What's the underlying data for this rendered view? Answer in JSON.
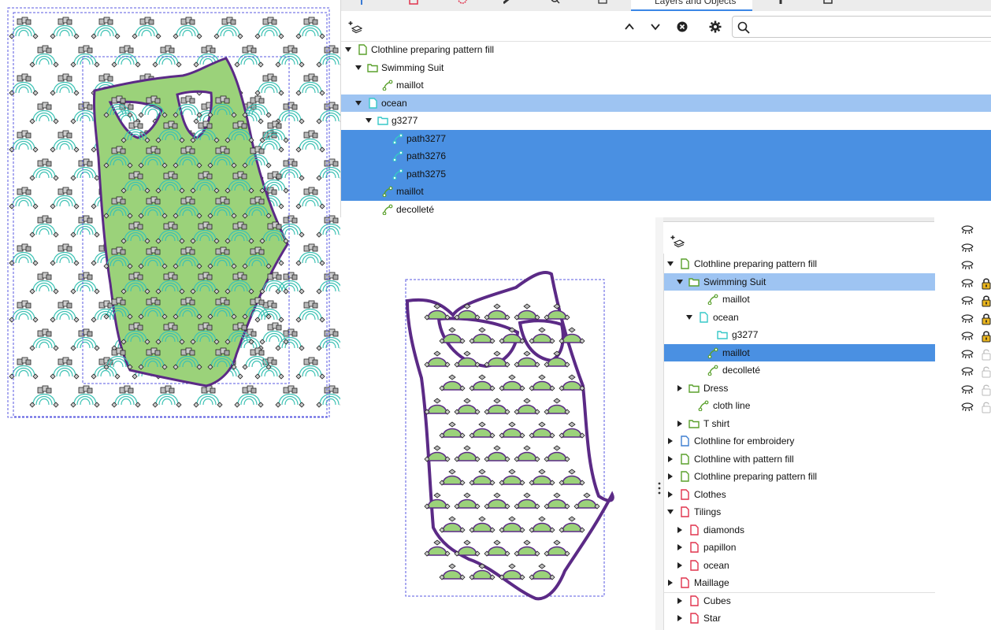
{
  "top_panel": {
    "tab_label": "Layers and Objects",
    "search": {
      "placeholder": "",
      "value": ""
    },
    "toolbar_icons": [
      "new-layer-icon",
      "raise-icon",
      "lower-icon",
      "delete-icon",
      "settings-icon",
      "search-icon"
    ],
    "rows": [
      {
        "label": "Clothline  preparing pattern fill",
        "indent": 0,
        "arrow": "down",
        "icon": "layer-icon",
        "color": "#5aa02c",
        "state": ""
      },
      {
        "label": "Swimming Suit",
        "indent": 1,
        "arrow": "down",
        "icon": "group-icon",
        "color": "#5aa02c",
        "state": ""
      },
      {
        "label": "maillot",
        "indent": 2,
        "arrow": "",
        "icon": "path-icon",
        "color": "#5aa02c",
        "state": ""
      },
      {
        "label": "ocean",
        "indent": 1,
        "arrow": "down",
        "icon": "layer-icon",
        "color": "#37c8c8",
        "state": "light"
      },
      {
        "label": "g3277",
        "indent": 2,
        "arrow": "down",
        "icon": "group-icon",
        "color": "#37c8c8",
        "state": ""
      },
      {
        "label": "path3277",
        "indent": 3,
        "arrow": "",
        "icon": "path-icon",
        "color": "#37c8c8",
        "state": "dark"
      },
      {
        "label": "path3276",
        "indent": 3,
        "arrow": "",
        "icon": "path-icon",
        "color": "#37c8c8",
        "state": "dark"
      },
      {
        "label": "path3275",
        "indent": 3,
        "arrow": "",
        "icon": "path-icon",
        "color": "#37c8c8",
        "state": "dark"
      },
      {
        "label": "maillot",
        "indent": 2,
        "arrow": "",
        "icon": "path-icon",
        "color": "#5aa02c",
        "state": "dark"
      },
      {
        "label": "decolleté",
        "indent": 2,
        "arrow": "",
        "icon": "path-icon",
        "color": "#5aa02c",
        "state": ""
      }
    ]
  },
  "bottom_panel": {
    "toolbar_icons": [
      "new-layer-icon"
    ],
    "rows": [
      {
        "label": "Clothline  preparing pattern fill",
        "indent": 0,
        "arrow": "down",
        "icon": "layer-icon",
        "color": "#5aa02c",
        "state": "",
        "eye": true,
        "lock": ""
      },
      {
        "label": "Swimming Suit",
        "indent": 1,
        "arrow": "down",
        "icon": "group-icon",
        "color": "#5aa02c",
        "state": "light",
        "eye": true,
        "lock": ""
      },
      {
        "label": "maillot",
        "indent": 2,
        "arrow": "",
        "icon": "path-icon",
        "color": "#5aa02c",
        "state": "",
        "eye": true,
        "lock": ""
      },
      {
        "label": "ocean",
        "indent": 2,
        "arrow": "down",
        "icon": "layer-icon",
        "color": "#37c8c8",
        "state": "",
        "eye": true,
        "lock": "locked"
      },
      {
        "label": "g3277",
        "indent": 3,
        "arrow": "",
        "icon": "group-icon",
        "color": "#37c8c8",
        "state": "",
        "eye": true,
        "lock": "locked"
      },
      {
        "label": "maillot",
        "indent": 2,
        "arrow": "",
        "icon": "path-icon",
        "color": "#5aa02c",
        "state": "dark",
        "eye": true,
        "lock": "locked"
      },
      {
        "label": "decolleté",
        "indent": 2,
        "arrow": "",
        "icon": "path-icon",
        "color": "#5aa02c",
        "state": "",
        "eye": true,
        "lock": "locked"
      },
      {
        "label": "Dress",
        "indent": 1,
        "arrow": "right",
        "icon": "group-icon",
        "color": "#5aa02c",
        "state": "",
        "eye": true,
        "lock": "unlocked"
      },
      {
        "label": "cloth line",
        "indent": 1,
        "arrow": "",
        "icon": "path-icon",
        "color": "#5aa02c",
        "state": "",
        "eye": true,
        "lock": "unlocked"
      },
      {
        "label": "T shirt",
        "indent": 1,
        "arrow": "right",
        "icon": "group-icon",
        "color": "#5aa02c",
        "state": "",
        "eye": true,
        "lock": "unlocked"
      },
      {
        "label": "Clothline for embroidery",
        "indent": 0,
        "arrow": "right",
        "icon": "layer-icon",
        "color": "#3f7fd1",
        "state": "",
        "eye": true,
        "lock": "unlocked"
      },
      {
        "label": "Clothline  with pattern fill",
        "indent": 0,
        "arrow": "right",
        "icon": "layer-icon",
        "color": "#5aa02c",
        "state": "",
        "eye": false,
        "lock": ""
      },
      {
        "label": "Clothline  preparing pattern fill",
        "indent": 0,
        "arrow": "right",
        "icon": "layer-icon",
        "color": "#5aa02c",
        "state": "",
        "eye": false,
        "lock": ""
      },
      {
        "label": "Clothes",
        "indent": 0,
        "arrow": "right",
        "icon": "layer-icon",
        "color": "#e0334d",
        "state": "",
        "eye": false,
        "lock": ""
      },
      {
        "label": "Tilings",
        "indent": 0,
        "arrow": "down",
        "icon": "layer-icon",
        "color": "#e0334d",
        "state": "",
        "eye": false,
        "lock": ""
      },
      {
        "label": "diamonds",
        "indent": 1,
        "arrow": "right",
        "icon": "layer-icon",
        "color": "#e0334d",
        "state": "",
        "eye": false,
        "lock": ""
      },
      {
        "label": "papillon",
        "indent": 1,
        "arrow": "right",
        "icon": "layer-icon",
        "color": "#e0334d",
        "state": "",
        "eye": false,
        "lock": ""
      },
      {
        "label": "ocean",
        "indent": 1,
        "arrow": "right",
        "icon": "layer-icon",
        "color": "#e0334d",
        "state": "",
        "eye": false,
        "lock": ""
      },
      {
        "label": "Maillage",
        "indent": 0,
        "arrow": "right",
        "icon": "layer-icon",
        "color": "#e0334d",
        "state": "underline",
        "eye": false,
        "lock": ""
      },
      {
        "label": "Cubes",
        "indent": 1,
        "arrow": "right",
        "icon": "layer-icon",
        "color": "#e0334d",
        "state": "",
        "eye": false,
        "lock": ""
      },
      {
        "label": "Star",
        "indent": 1,
        "arrow": "right",
        "icon": "layer-icon",
        "color": "#e0334d",
        "state": "",
        "eye": false,
        "lock": ""
      }
    ]
  },
  "colors": {
    "selection_light": "#9ec4f2",
    "selection_dark": "#4a90e2",
    "suit_fill": "#9bd27a",
    "suit_outline": "#5b2a86",
    "tile_teal": "#3cc2b4",
    "bbox_dash": "#5a5ae0"
  }
}
